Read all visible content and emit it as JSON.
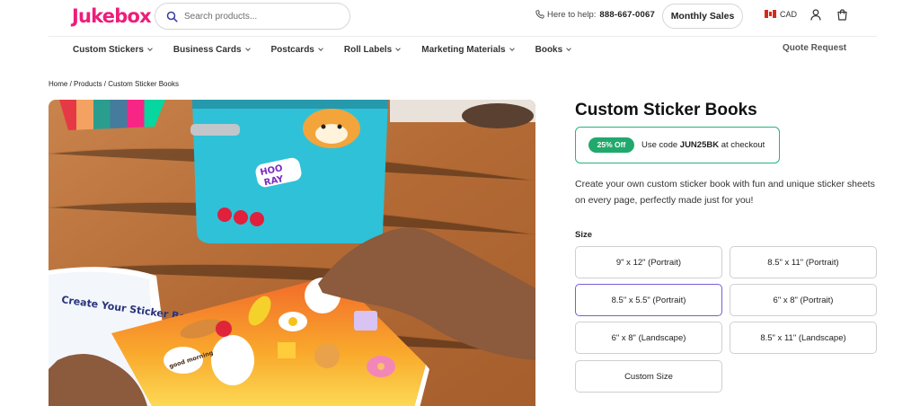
{
  "brand": {
    "logo_text": "Jukebox",
    "accent": "#ee1d79"
  },
  "header": {
    "search_placeholder": "Search products...",
    "help_label": "Here to help:",
    "phone": "888-667-0067",
    "monthly_sales_label": "Monthly Sales",
    "currency": "CAD",
    "icons": [
      "search-icon",
      "phone-icon",
      "canada-flag-icon",
      "user-icon",
      "cart-icon"
    ]
  },
  "nav": {
    "items": [
      {
        "label": "Custom Stickers"
      },
      {
        "label": "Business Cards"
      },
      {
        "label": "Postcards"
      },
      {
        "label": "Roll Labels"
      },
      {
        "label": "Marketing Materials"
      },
      {
        "label": "Books"
      }
    ],
    "quote_label": "Quote Request"
  },
  "breadcrumb": "Home / Products / Custom Sticker Books",
  "hero_image": {
    "cover_text": "Create Your Sticker Book",
    "stickers": [
      "HOO RAY",
      "good morning"
    ]
  },
  "product": {
    "title": "Custom Sticker Books",
    "promo": {
      "badge": "25% Off",
      "prefix": "Use code",
      "code": "JUN25BK",
      "suffix": "at checkout",
      "color": "#21a96d"
    },
    "description": "Create your own custom sticker book with fun and unique sticker sheets on every page, perfectly made just for you!",
    "size_label": "Size",
    "selected_color": "#7b5cd6",
    "sizes": [
      {
        "label": "9\" x 12\" (Portrait)",
        "selected": false
      },
      {
        "label": "8.5\" x 11\" (Portrait)",
        "selected": false
      },
      {
        "label": "8.5\" x 5.5\" (Portrait)",
        "selected": true
      },
      {
        "label": "6\" x 8\" (Portrait)",
        "selected": false
      },
      {
        "label": "6\" x 8\" (Landscape)",
        "selected": false
      },
      {
        "label": "8.5\" x 11\" (Landscape)",
        "selected": false
      },
      {
        "label": "Custom Size",
        "selected": false
      }
    ]
  }
}
